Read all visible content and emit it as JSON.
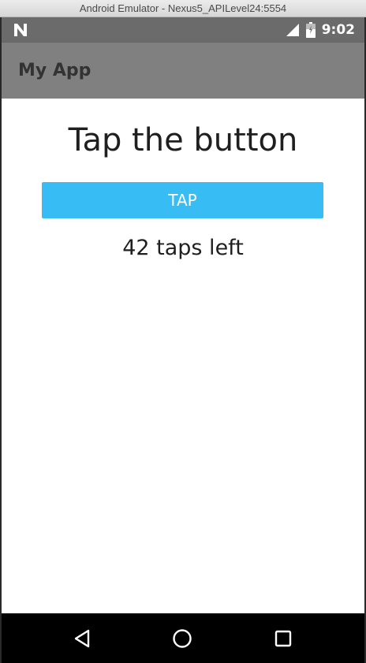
{
  "window": {
    "title": "Android Emulator - Nexus5_APILevel24:5554"
  },
  "status_bar": {
    "time": "9:02",
    "icons": [
      "n-notification-icon",
      "signal-icon",
      "battery-icon"
    ]
  },
  "app_bar": {
    "title": "My App",
    "background_color": "#808080"
  },
  "main": {
    "heading": "Tap the button",
    "button_label": "TAP",
    "button_color": "#37bcf4",
    "taps_remaining_text": "42 taps left"
  },
  "nav_bar": {
    "icons": [
      "back-icon",
      "home-icon",
      "recents-icon"
    ]
  }
}
